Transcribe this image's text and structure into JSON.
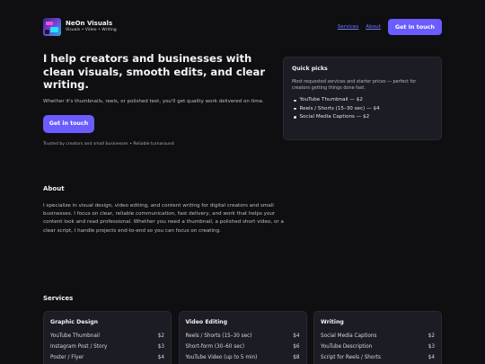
{
  "brand": {
    "name": "NeOn Visuals",
    "tagline": "Visuals • Video • Writing"
  },
  "nav": {
    "links": [
      "Services",
      "About"
    ],
    "cta": "Get in touch"
  },
  "hero": {
    "title": "I help creators and businesses with clean visuals, smooth edits, and clear writing.",
    "description": "Whether it's thumbnails, reels, or polished text, you'll get quality work delivered on time.",
    "cta": "Get in touch",
    "trust": "Trusted by creators and small businesses • Reliable turnaround"
  },
  "quick_picks": {
    "title": "Quick picks",
    "description": "Most requested services and starter prices — perfect for creators getting things done fast.",
    "items": [
      "YouTube Thumbnail — $2",
      "Reels / Shorts (15–30 sec) — $4",
      "Social Media Captions — $2"
    ]
  },
  "about": {
    "title": "About",
    "text": "I specialize in visual design, video editing, and content writing for digital creators and small businesses. I focus on clear, reliable communication, fast delivery, and work that helps your content look and read professional. Whether you need a thumbnail, a polished short video, or a clear script, I handle projects end-to-end so you can focus on creating."
  },
  "services": {
    "title": "Services",
    "cards": [
      {
        "title": "Graphic Design",
        "rows": [
          {
            "name": "YouTube Thumbnail",
            "price": "$2"
          },
          {
            "name": "Instagram Post / Story",
            "price": "$3"
          },
          {
            "name": "Poster / Flyer",
            "price": "$4"
          }
        ]
      },
      {
        "title": "Video Editing",
        "rows": [
          {
            "name": "Reels / Shorts (15–30 sec)",
            "price": "$4"
          },
          {
            "name": "Short-form (30–60 sec)",
            "price": "$6"
          },
          {
            "name": "YouTube Video (up to 5 min)",
            "price": "$8"
          }
        ]
      },
      {
        "title": "Writing",
        "rows": [
          {
            "name": "Social Media Captions",
            "price": "$2"
          },
          {
            "name": "YouTube Description",
            "price": "$3"
          },
          {
            "name": "Script for Reels / Shorts",
            "price": "$4"
          }
        ]
      }
    ]
  },
  "colors": {
    "accent": "#6a5cff",
    "link": "#6b7bff",
    "background": "#0f0f12",
    "card": "#1c1c24"
  }
}
